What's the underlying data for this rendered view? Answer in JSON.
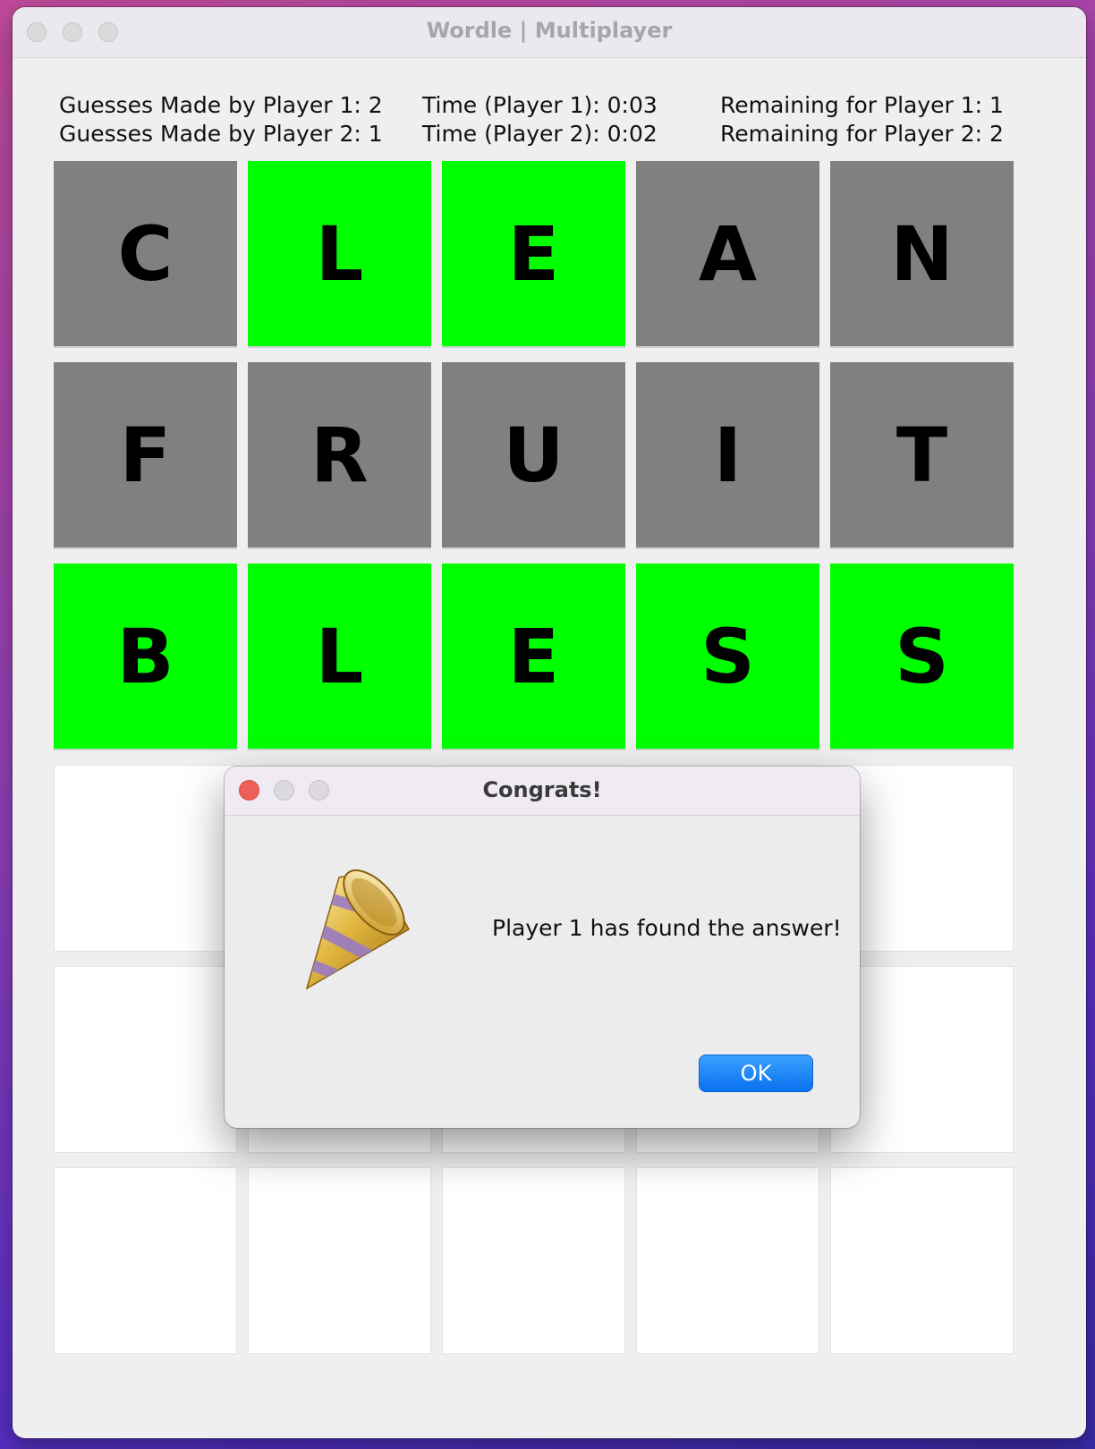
{
  "window": {
    "title": "Wordle | Multiplayer"
  },
  "stats": {
    "guesses_p1": "Guesses Made by Player 1: 2",
    "guesses_p2": "Guesses Made by Player 2: 1",
    "time_p1": "Time (Player 1): 0:03",
    "time_p2": "Time (Player 2): 0:02",
    "remaining_p1": "Remaining for Player 1: 1",
    "remaining_p2": "Remaining for Player 2: 2"
  },
  "board": {
    "rows": [
      [
        {
          "letter": "C",
          "state": "gray"
        },
        {
          "letter": "L",
          "state": "green"
        },
        {
          "letter": "E",
          "state": "green"
        },
        {
          "letter": "A",
          "state": "gray"
        },
        {
          "letter": "N",
          "state": "gray"
        }
      ],
      [
        {
          "letter": "F",
          "state": "gray"
        },
        {
          "letter": "R",
          "state": "gray"
        },
        {
          "letter": "U",
          "state": "gray"
        },
        {
          "letter": "I",
          "state": "gray"
        },
        {
          "letter": "T",
          "state": "gray"
        }
      ],
      [
        {
          "letter": "B",
          "state": "green"
        },
        {
          "letter": "L",
          "state": "green"
        },
        {
          "letter": "E",
          "state": "green"
        },
        {
          "letter": "S",
          "state": "green"
        },
        {
          "letter": "S",
          "state": "green"
        }
      ],
      [
        {
          "letter": "",
          "state": "empty"
        },
        {
          "letter": "",
          "state": "empty"
        },
        {
          "letter": "",
          "state": "empty"
        },
        {
          "letter": "",
          "state": "empty"
        },
        {
          "letter": "",
          "state": "empty"
        }
      ],
      [
        {
          "letter": "",
          "state": "empty"
        },
        {
          "letter": "",
          "state": "empty"
        },
        {
          "letter": "",
          "state": "empty"
        },
        {
          "letter": "",
          "state": "empty"
        },
        {
          "letter": "",
          "state": "empty"
        }
      ],
      [
        {
          "letter": "",
          "state": "empty"
        },
        {
          "letter": "",
          "state": "empty"
        },
        {
          "letter": "",
          "state": "empty"
        },
        {
          "letter": "",
          "state": "empty"
        },
        {
          "letter": "",
          "state": "empty"
        }
      ]
    ]
  },
  "dialog": {
    "title": "Congrats!",
    "message": "Player 1 has found the answer!",
    "ok_label": "OK",
    "icon": "party-horn-icon"
  },
  "colors": {
    "green": "#00ff00",
    "gray": "#808080",
    "empty": "#ffffff",
    "ok_button": "#0a72f0"
  }
}
